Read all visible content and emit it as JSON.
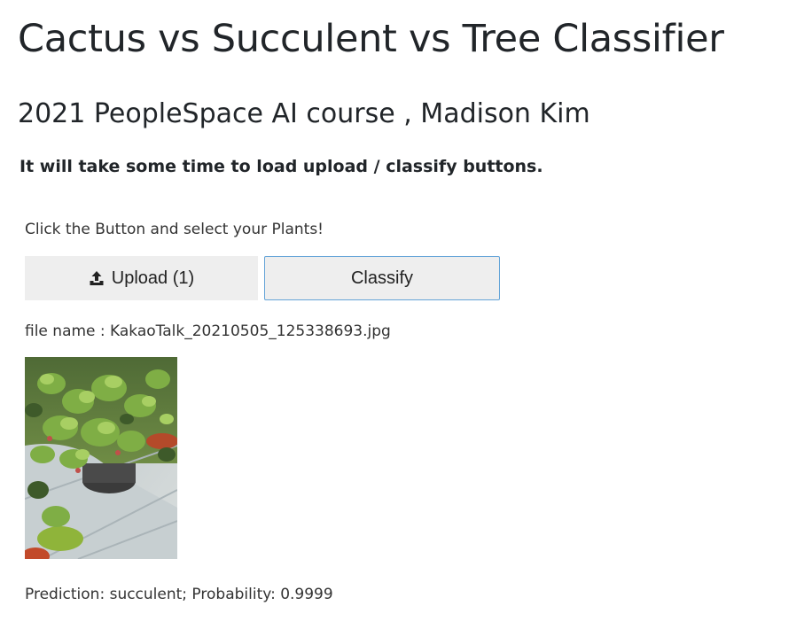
{
  "page": {
    "title": "Cactus vs Succulent vs Tree Classifier",
    "subtitle": "2021 PeopleSpace AI course , Madison Kim",
    "notice": "It will take some time to load upload / classify buttons."
  },
  "upload_section": {
    "instruction": "Click the Button and select your Plants!",
    "upload_label": "Upload (1)",
    "upload_icon": "upload-icon",
    "classify_label": "Classify",
    "file_name": "file name : KakaoTalk_20210505_125338693.jpg"
  },
  "result": {
    "prediction_text": "Prediction: succulent; Probability: 0.9999"
  },
  "colors": {
    "button_bg": "#eeeeee",
    "focus_border": "#64a4d8",
    "text": "#212529"
  }
}
